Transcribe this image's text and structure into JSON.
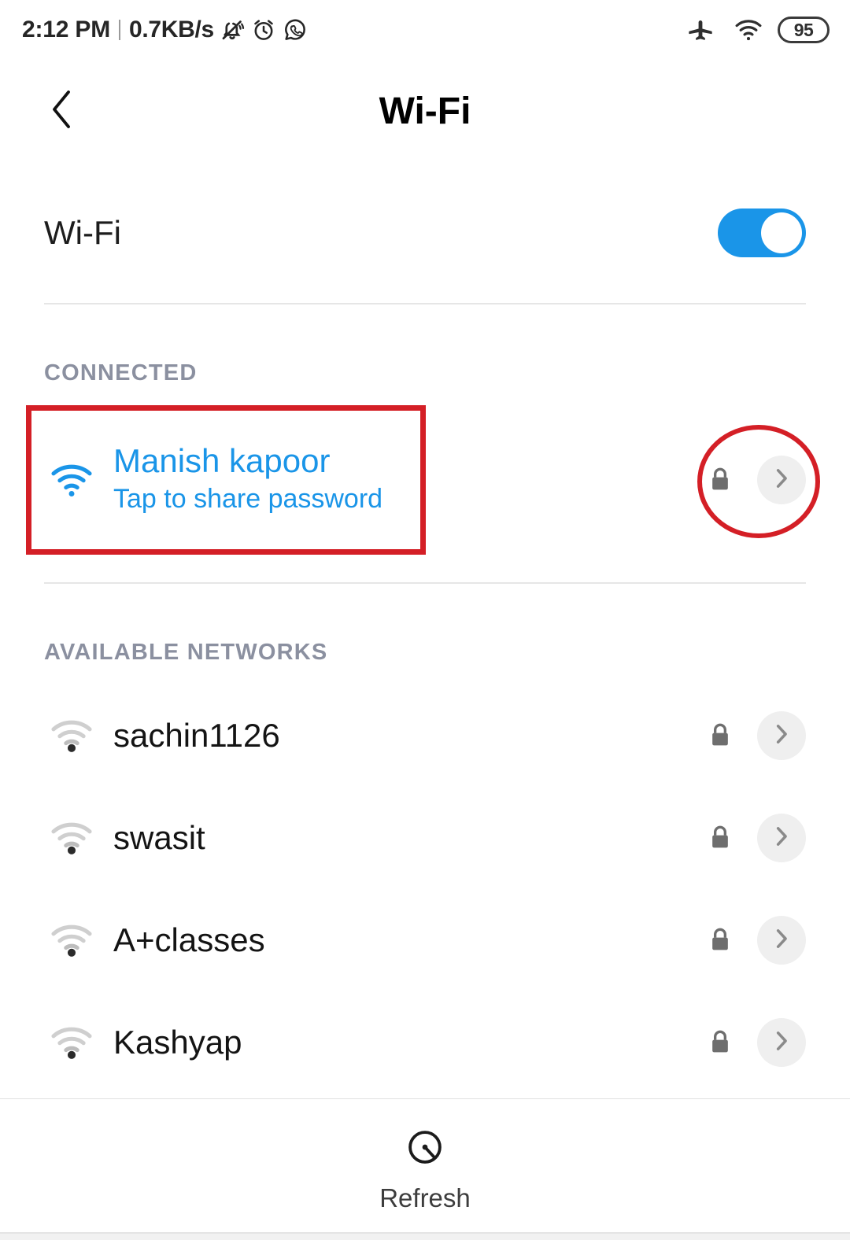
{
  "status_bar": {
    "time": "2:12 PM",
    "network_speed": "0.7KB/s",
    "left_icons": [
      "mute-bell-icon",
      "alarm-clock-icon",
      "whatsapp-icon"
    ],
    "right_icons": [
      "airplane-mode-icon",
      "wifi-signal-icon"
    ],
    "battery_level": "95"
  },
  "app_bar": {
    "back_icon": "chevron-left-icon",
    "title": "Wi-Fi"
  },
  "wifi_toggle": {
    "label": "Wi-Fi",
    "state": "on",
    "accent_color": "#1a95e8"
  },
  "connected_section": {
    "header": "CONNECTED",
    "network": {
      "name": "Manish kapoor",
      "subtitle": "Tap to share password",
      "signal_icon": "wifi-full-icon",
      "secured_icon": "lock-icon",
      "detail_icon": "chevron-right-icon",
      "text_color": "#1a95e8"
    }
  },
  "available_section": {
    "header": "AVAILABLE NETWORKS",
    "networks": [
      {
        "name": "sachin1126",
        "signal_icon": "wifi-weak-icon",
        "secured_icon": "lock-icon",
        "detail_icon": "chevron-right-icon"
      },
      {
        "name": "swasit",
        "signal_icon": "wifi-weak-icon",
        "secured_icon": "lock-icon",
        "detail_icon": "chevron-right-icon"
      },
      {
        "name": "A+classes",
        "signal_icon": "wifi-weak-icon",
        "secured_icon": "lock-icon",
        "detail_icon": "chevron-right-icon"
      },
      {
        "name": "Kashyap",
        "signal_icon": "wifi-weak-icon",
        "secured_icon": "lock-icon",
        "detail_icon": "chevron-right-icon"
      }
    ]
  },
  "bottom_bar": {
    "refresh_label": "Refresh",
    "refresh_icon": "scan-refresh-icon"
  },
  "annotations": {
    "highlight_color": "#d41f26",
    "rectangle_target": "connected-network-row",
    "ellipse_target": "connected-network-detail-controls"
  }
}
